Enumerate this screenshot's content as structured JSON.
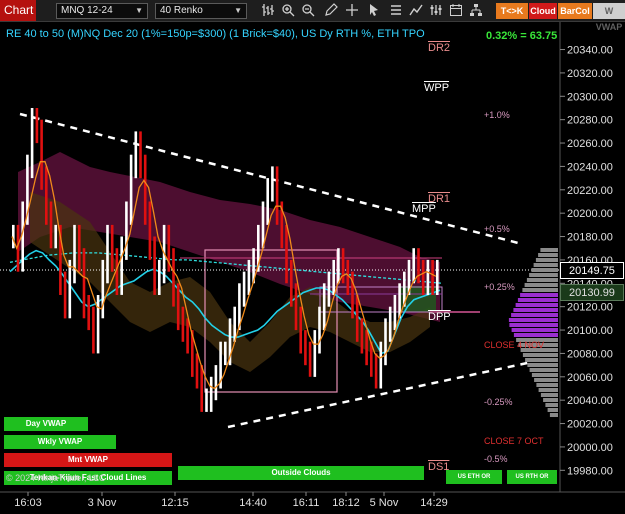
{
  "toolbar": {
    "chart_label": "Chart",
    "instrument": "MNQ 12-24",
    "bar_type": "40 Renko",
    "buttons": [
      {
        "label": "T<>K",
        "bg": "#e87a1e",
        "fg": "#ffffff"
      },
      {
        "label": "Cloud",
        "bg": "#d01a1a",
        "fg": "#ffffff"
      },
      {
        "label": "BarCol",
        "bg": "#e87a1e",
        "fg": "#ffffff"
      },
      {
        "label": "W VWAP",
        "bg": "#cfcfcf",
        "fg": "#606060"
      }
    ],
    "icons": [
      "bars-icon",
      "zoom-in-icon",
      "zoom-out-icon",
      "pencil-icon",
      "crosshair-icon",
      "pointer-icon",
      "list-icon",
      "draw-icon",
      "properties-icon",
      "calendar-icon",
      "hierarchy-icon"
    ]
  },
  "chart": {
    "title": "RE 40 to 50 (M)NQ Dec 20 (1%=150p=$300) (1 Brick=$40), US Dy RTH %, ETH TPO",
    "pct_readout": "0.32% = 63.75",
    "last_price": "20149.75",
    "secondary_price": "20130.99",
    "levels": [
      {
        "label": "DR2",
        "color": "#e88c8c",
        "overline": true
      },
      {
        "label": "WPP",
        "color": "#ffffff",
        "overline": true
      },
      {
        "label": "DR1",
        "color": "#e88c8c",
        "overline": true
      },
      {
        "label": "MPP",
        "color": "#ffffff",
        "overline": true
      },
      {
        "label": "DPP",
        "color": "#ffffff",
        "overline": true
      },
      {
        "label": "DS1",
        "color": "#e88c8c",
        "overline": true
      }
    ],
    "pct_levels": [
      "+1.0%",
      "+0.5%",
      "+0.25%",
      "-0.25%",
      "-0.5%"
    ],
    "close_labels": [
      "CLOSE 4 NOV",
      "CLOSE 7 OCT"
    ],
    "copyright": "© 2024 NinjaTrader, LLC",
    "indicator_pills": [
      {
        "label": "Day VWAP",
        "color": "#1fbf1f"
      },
      {
        "label": "Wkly VWAP",
        "color": "#1fbf1f"
      },
      {
        "label": "Mnt VWAP",
        "color": "#d41616"
      },
      {
        "label": "Tenkan-Kijun Fast Cloud Lines",
        "color": "#1fbf1f"
      },
      {
        "label": "Outside Clouds",
        "color": "#1fbf1f"
      },
      {
        "label": "US ETH OR",
        "color": "#1fbf1f"
      },
      {
        "label": "US RTH OR",
        "color": "#1fbf1f"
      }
    ]
  },
  "chart_data": {
    "type": "line",
    "y_axis": {
      "ticks": [
        "20340.00",
        "20320.00",
        "20300.00",
        "20280.00",
        "20260.00",
        "20240.00",
        "20220.00",
        "20200.00",
        "20180.00",
        "20160.00",
        "20140.00",
        "20120.00",
        "20100.00",
        "20080.00",
        "20060.00",
        "20040.00",
        "20020.00",
        "20000.00",
        "19980.00"
      ],
      "ylim": [
        19970,
        20355
      ]
    },
    "x_axis": {
      "ticks": [
        "16:03",
        "3 Nov",
        "12:15",
        "14:40",
        "16:11",
        "18:12",
        "5 Nov",
        "14:29"
      ]
    },
    "series": [
      {
        "name": "Day VWAP",
        "color": "#22d0e8"
      },
      {
        "name": "Wkly VWAP",
        "color": "#2fe0e0"
      },
      {
        "name": "Mnt VWAP",
        "color": "#e83030"
      }
    ],
    "price_close": [
      20180,
      20160,
      20200,
      20240,
      20280,
      20270,
      20230,
      20200,
      20180,
      20180,
      20140,
      20120,
      20150,
      20180,
      20160,
      20120,
      20110,
      20090,
      20120,
      20150,
      20180,
      20160,
      20140,
      20170,
      20200,
      20240,
      20260,
      20240,
      20200,
      20170,
      20140,
      20150,
      20180,
      20160,
      20130,
      20110,
      20100,
      20090,
      20070,
      20060,
      20040,
      20040,
      20050,
      20060,
      20080,
      20080,
      20100,
      20110,
      20130,
      20140,
      20150,
      20160,
      20180,
      20200,
      20220,
      20230,
      20200,
      20180,
      20150,
      20130,
      20110,
      20090,
      20080,
      20070,
      20090,
      20110,
      20130,
      20140,
      20150,
      20160,
      20150,
      20140,
      20120,
      20100,
      20090,
      20080,
      20070,
      20060,
      20080,
      20100,
      20110,
      20120,
      20130,
      20140,
      20150,
      20160,
      20150,
      20140,
      20150,
      20140,
      20150
    ],
    "day_vwap": [
      20150,
      20155,
      20160,
      20165,
      20168,
      20166,
      20160,
      20155,
      20148,
      20140,
      20132,
      20124,
      20120,
      20122,
      20126,
      20130,
      20134,
      20138,
      20140,
      20142,
      20146,
      20150,
      20152,
      20150,
      20146,
      20140,
      20134,
      20128,
      20124,
      20118,
      20110,
      20104,
      20100,
      20096,
      20094,
      20094,
      20096,
      20098,
      20100,
      20104,
      20110,
      20116,
      20120,
      20124,
      20128,
      20132,
      20134,
      20136,
      20136,
      20134,
      20130,
      20126,
      20120,
      20114,
      20108,
      20100,
      20090,
      20080,
      20082,
      20096,
      20110,
      20120,
      20126,
      20128,
      20130,
      20132,
      20134
    ],
    "wkly_vwap": [
      20158,
      20160,
      20162,
      20164,
      20165,
      20166,
      20166,
      20166,
      20165,
      20164,
      20163,
      20162,
      20161,
      20160,
      20160,
      20159,
      20158,
      20157,
      20156,
      20155,
      20154,
      20153,
      20152,
      20151,
      20150,
      20149,
      20148,
      20147,
      20146,
      20145,
      20144,
      20143,
      20142,
      20141,
      20140
    ],
    "channel_upper": [
      20290,
      20170
    ],
    "channel_lower": [
      20010,
      20075
    ]
  }
}
